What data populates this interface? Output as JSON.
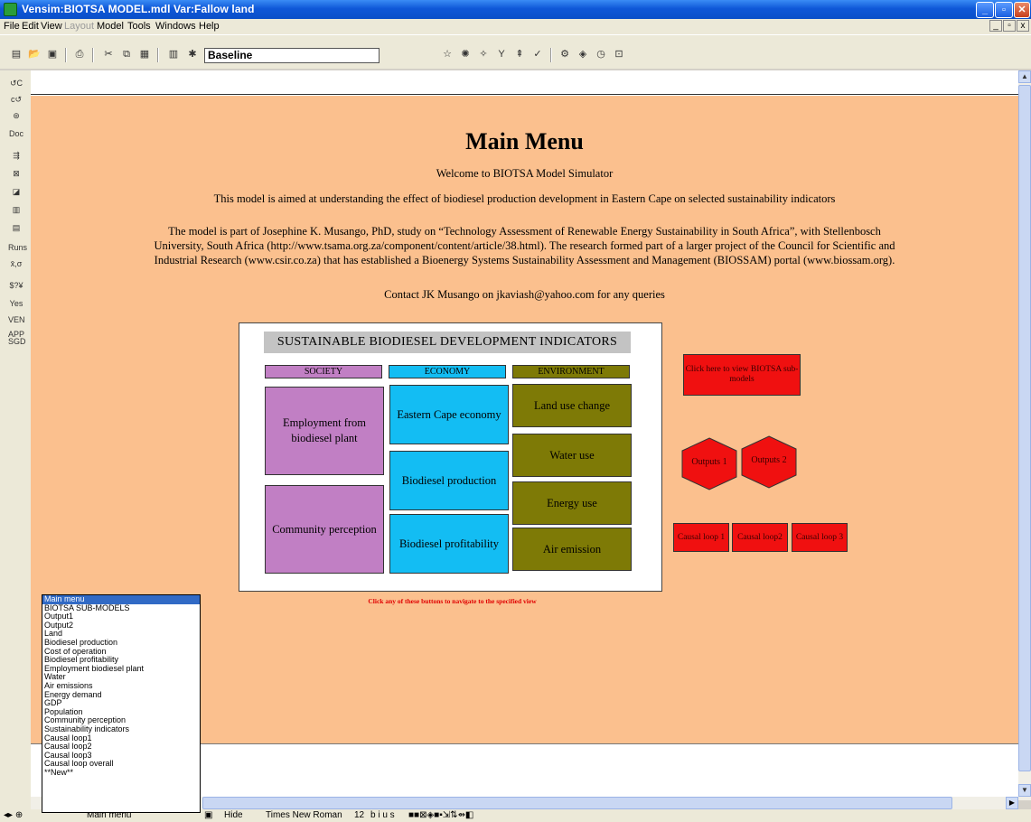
{
  "window": {
    "title": "Vensim:BIOTSA MODEL.mdl Var:Fallow land"
  },
  "menu": [
    "File",
    "Edit",
    "View",
    "Layout",
    "Model",
    "Tools",
    "Windows",
    "Help"
  ],
  "toolbar": {
    "run_name": "Baseline"
  },
  "left_tools": [
    "↺C",
    "c↺",
    "⊛",
    "Doc",
    "⇶",
    "⊠",
    "◪",
    "▥",
    "▤",
    "Runs",
    "x̄,σ",
    "$?¥",
    "Yes",
    "VEN APP",
    "SGD"
  ],
  "content": {
    "heading": "Main Menu",
    "welcome": "Welcome to BIOTSA Model Simulator",
    "aim": "This model is aimed at understanding the effect of biodiesel production development in Eastern Cape on selected sustainability indicators",
    "part_line1": "The model is part of Josephine K. Musango, PhD, study on “Technology Assessment of Renewable Energy Sustainability in South Africa”, with Stellenbosch",
    "part_line2": "University, South Africa (http://www.tsama.org.za/component/content/article/38.html). The research formed part of a larger project of the Council for Scientific and",
    "part_line3": "Industrial Research (www.csir.co.za) that has established a Bioenergy Systems Sustainability Assessment and Management (BIOSSAM) portal (www.biossam.org).",
    "contact": "Contact JK Musango on jkaviash@yahoo.com for any queries"
  },
  "indicators": {
    "title": "SUSTAINABLE BIODIESEL DEVELOPMENT INDICATORS",
    "society": "SOCIETY",
    "economy": "ECONOMY",
    "environment": "ENVIRONMENT",
    "employment": "Employment from biodiesel plant",
    "community": "Community perception",
    "ec_economy": "Eastern Cape economy",
    "production": "Biodiesel production",
    "profitability": "Biodiesel profitability",
    "land": "Land use change",
    "water": "Water use",
    "energy": "Energy use",
    "air": "Air emission",
    "nav_note": "Click any of these buttons to navigate to the specified view"
  },
  "side_buttons": {
    "submodels": "Click here to view BIOTSA sub-models",
    "outputs1": "Outputs 1",
    "outputs2": "Outputs 2",
    "causal1": "Causal loop 1",
    "causal2": "Causal loop2",
    "causal3": "Causal loop 3"
  },
  "view_list": [
    "Main menu",
    "BIOTSA SUB-MODELS",
    "Output1",
    "Output2",
    "Land",
    "Biodiesel production",
    "Cost of operation",
    "Biodiesel profitability",
    "Employment biodiesel plant",
    "Water",
    "Air emissions",
    "Energy demand",
    "GDP",
    "Population",
    "Community perception",
    "Sustainability indicators",
    "Causal loop1",
    "Causal loop2",
    "Causal loop3",
    "Causal loop overall",
    "**New**"
  ],
  "status": {
    "view": "Main menu",
    "hide": "Hide",
    "font": "Times New Roman",
    "size": "12",
    "styles": "b i u s"
  }
}
